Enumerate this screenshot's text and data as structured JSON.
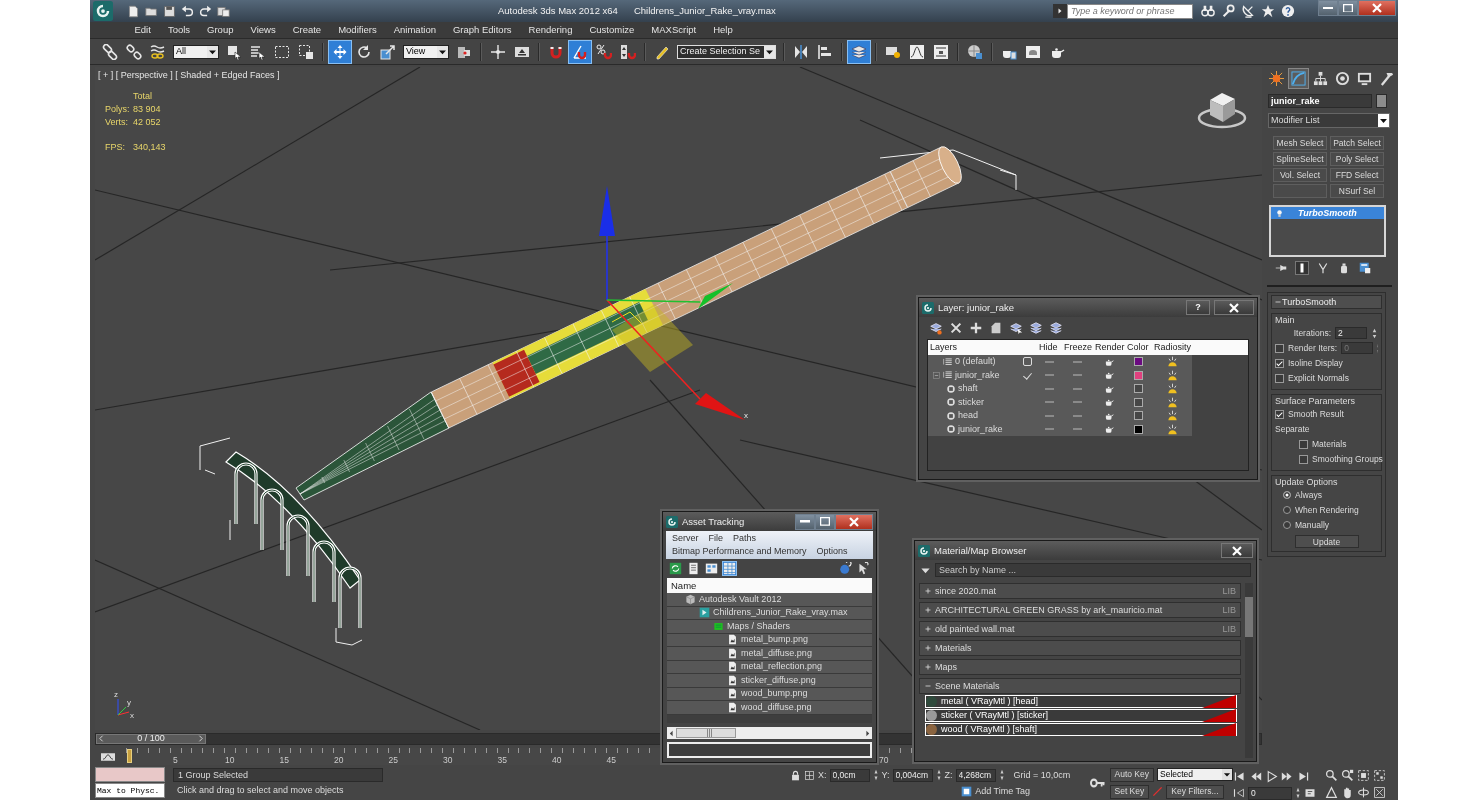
{
  "title_bar": {
    "app_title": "Autodesk 3ds Max  2012 x64",
    "file_name": "Childrens_Junior_Rake_vray.max",
    "search": {
      "placeholder": "Type a keyword or phrase"
    }
  },
  "menu": [
    "Edit",
    "Tools",
    "Group",
    "Views",
    "Create",
    "Modifiers",
    "Animation",
    "Graph Editors",
    "Rendering",
    "Customize",
    "MAXScript",
    "Help"
  ],
  "toolbar": {
    "groups": [
      [
        {
          "kind": "tool",
          "selected": false
        },
        {
          "kind": "tool",
          "selected": false
        },
        {
          "kind": "tool",
          "selected": false
        },
        {
          "kind": "dropdown",
          "value": "All"
        },
        {
          "kind": "tool",
          "selected": false
        },
        {
          "kind": "tool",
          "selected": false
        },
        {
          "kind": "tool",
          "selected": false
        },
        {
          "kind": "tool",
          "selected": false
        }
      ],
      [
        {
          "kind": "tool",
          "selected": true
        },
        {
          "kind": "tool",
          "selected": false
        },
        {
          "kind": "tool",
          "selected": false
        },
        {
          "kind": "dropdown",
          "value": "View"
        },
        {
          "kind": "tool",
          "selected": false
        }
      ],
      [
        {
          "kind": "tool",
          "selected": false
        },
        {
          "kind": "tool",
          "selected": false
        }
      ],
      [
        {
          "kind": "tool",
          "selected": false
        },
        {
          "kind": "tool",
          "selected": true
        },
        {
          "kind": "tool",
          "selected": false
        },
        {
          "kind": "tool",
          "selected": false
        }
      ],
      [
        {
          "kind": "tool",
          "selected": false
        },
        {
          "kind": "combo",
          "value": "Create Selection Se"
        }
      ],
      [
        {
          "kind": "tool",
          "selected": false
        },
        {
          "kind": "tool",
          "selected": false
        }
      ],
      [
        {
          "kind": "tool",
          "selected": true
        }
      ],
      [
        {
          "kind": "tool",
          "selected": false
        },
        {
          "kind": "tool",
          "selected": false
        },
        {
          "kind": "tool",
          "selected": false
        }
      ],
      [
        {
          "kind": "tool",
          "selected": false
        }
      ],
      [
        {
          "kind": "tool",
          "selected": false
        },
        {
          "kind": "tool",
          "selected": false
        },
        {
          "kind": "tool",
          "selected": false
        }
      ]
    ]
  },
  "viewport": {
    "label": "[ + ] [ Perspective ] [ Shaded + Edged Faces ]",
    "stats": {
      "heading": "Total",
      "rows": [
        {
          "label": "Polys:",
          "value": "83 904"
        },
        {
          "label": "Verts:",
          "value": "42 052"
        }
      ],
      "fps": {
        "label": "FPS:",
        "value": "340,143"
      }
    },
    "gizmo_label": "x",
    "tripod_labels": [
      "z",
      "y",
      "x"
    ]
  },
  "command_panel": {
    "tabs": [
      {
        "selected": false
      },
      {
        "selected": true
      },
      {
        "selected": false
      },
      {
        "selected": false
      },
      {
        "selected": false
      },
      {
        "selected": false
      }
    ],
    "object_name": "junior_rake",
    "modifier_list": "Modifier List",
    "modifier_buttons": [
      {
        "kind": "labeled",
        "label": "Mesh Select"
      },
      {
        "kind": "labeled",
        "label": "Patch Select"
      },
      {
        "kind": "labeled",
        "label": "SplineSelect"
      },
      {
        "kind": "labeled",
        "label": "Poly Select"
      },
      {
        "kind": "labeled",
        "label": "Vol. Select"
      },
      {
        "kind": "labeled",
        "label": "FFD Select"
      },
      {
        "kind": "blank"
      },
      {
        "kind": "labeled",
        "label": "NSurf Sel"
      }
    ],
    "stack": [
      {
        "label": "TurboSmooth",
        "selected": true
      }
    ],
    "stack_tools": [
      {
        "selected": false
      },
      {
        "selected": true
      },
      {
        "selected": false
      },
      {
        "selected": false
      },
      {
        "selected": false
      }
    ],
    "rollout": {
      "title": "TurboSmooth",
      "expanded": true,
      "groups": [
        {
          "title": "Main",
          "controls": [
            {
              "kind": "spinner",
              "label": "Iterations:",
              "value": "2",
              "disabled": false
            },
            {
              "kind": "check_spinner",
              "label": "Render Iters:",
              "checked": false,
              "value": "0",
              "disabled": true
            },
            {
              "kind": "checkbox",
              "label": "Isoline Display",
              "checked": true
            },
            {
              "kind": "checkbox",
              "label": "Explicit Normals",
              "checked": false
            }
          ]
        },
        {
          "title": "Surface Parameters",
          "controls": [
            {
              "kind": "checkbox",
              "label": "Smooth Result",
              "checked": true
            },
            {
              "kind": "label",
              "label": "Separate"
            },
            {
              "kind": "sub_checkbox",
              "label": "Materials",
              "checked": false
            },
            {
              "kind": "sub_checkbox",
              "label": "Smoothing Groups",
              "checked": false
            }
          ]
        },
        {
          "title": "Update Options",
          "controls": [
            {
              "kind": "radio",
              "label": "Always",
              "selected": true
            },
            {
              "kind": "radio",
              "label": "When Rendering",
              "selected": false
            },
            {
              "kind": "radio",
              "label": "Manually",
              "selected": false
            },
            {
              "kind": "button",
              "label": "Update"
            }
          ]
        }
      ]
    }
  },
  "layer_dialog": {
    "title": "Layer: junior_rake",
    "help_button": "?",
    "columns": [
      "Layers",
      "Hide",
      "Freeze",
      "Render",
      "Color",
      "Radiosity"
    ],
    "layers": [
      {
        "name": "0 (default)",
        "current": false,
        "hidden": false,
        "frozen": false,
        "color": "#6a0a80"
      },
      {
        "name": "junior_rake",
        "current": true,
        "expanded": true,
        "hidden": false,
        "frozen": false,
        "color": "#e0407e",
        "children": [
          {
            "name": "shaft",
            "hidden": false,
            "frozen": false,
            "color": "#464646"
          },
          {
            "name": "sticker",
            "hidden": false,
            "frozen": false,
            "color": "#464646"
          },
          {
            "name": "head",
            "hidden": false,
            "frozen": false,
            "color": "#464646"
          },
          {
            "name": "junior_rake",
            "hidden": false,
            "frozen": false,
            "color": "#000000"
          }
        ]
      }
    ]
  },
  "asset_tracking": {
    "title": "Asset Tracking",
    "menu": [
      [
        "Server",
        "File",
        "Paths"
      ],
      [
        "Bitmap Performance and Memory",
        "Options"
      ]
    ],
    "toolbar": [
      {
        "selected": false
      },
      {
        "selected": false
      },
      {
        "selected": false
      },
      {
        "selected": true
      }
    ],
    "column": "Name",
    "tree": [
      {
        "kind": "vault",
        "label": "Autodesk Vault 2012",
        "children": [
          {
            "kind": "max_file",
            "label": "Childrens_Junior_Rake_vray.max",
            "children": [
              {
                "kind": "maps",
                "label": "Maps / Shaders",
                "children": [
                  {
                    "kind": "image",
                    "label": "metal_bump.png"
                  },
                  {
                    "kind": "image",
                    "label": "metal_diffuse.png"
                  },
                  {
                    "kind": "image",
                    "label": "metal_reflection.png"
                  },
                  {
                    "kind": "image",
                    "label": "sticker_diffuse.png"
                  },
                  {
                    "kind": "image",
                    "label": "wood_bump.png"
                  },
                  {
                    "kind": "image",
                    "label": "wood_diffuse.png"
                  }
                ]
              }
            ]
          }
        ]
      }
    ]
  },
  "material_browser": {
    "title": "Material/Map Browser",
    "search": {
      "placeholder": "Search by Name ..."
    },
    "groups": [
      {
        "label": "since 2020.mat",
        "expanded": false,
        "tag": "LIB"
      },
      {
        "label": "ARCHITECTURAL GREEN GRASS by ark_mauricio.mat",
        "expanded": false,
        "tag": "LIB"
      },
      {
        "label": "old painted wall.mat",
        "expanded": false,
        "tag": "LIB"
      },
      {
        "label": "Materials",
        "expanded": false
      },
      {
        "label": "Maps",
        "expanded": false
      },
      {
        "label": "Scene Materials",
        "expanded": true,
        "items": [
          {
            "label": "metal  ( VRayMtl )  [head]",
            "color": "#2f4a3c"
          },
          {
            "label": "sticker  ( VRayMtl )  [sticker]",
            "color": "#9a9a9a"
          },
          {
            "label": "wood  ( VRayMtl )  [shaft]",
            "color": "#8a6440"
          }
        ]
      }
    ]
  },
  "timeline": {
    "slider": "0 / 100",
    "ruler_labels": [
      "5",
      "10",
      "15",
      "20",
      "25",
      "30",
      "35",
      "40",
      "45",
      "70"
    ]
  },
  "status": {
    "listener": "Max to Physc.",
    "selection": "1 Group Selected",
    "prompt": "Click and drag to select and move objects",
    "coords": [
      {
        "label": "X:",
        "value": "0,0cm"
      },
      {
        "label": "Y:",
        "value": "0,004cm"
      },
      {
        "label": "Z:",
        "value": "4,268cm"
      }
    ],
    "grid": "Grid = 10,0cm",
    "time_tag": "Add Time Tag",
    "auto_key": {
      "label": "Auto Key",
      "on": false
    },
    "key_mode": "Selected",
    "set_key": "Set Key",
    "key_filters": "Key Filters...",
    "frame": "0"
  }
}
